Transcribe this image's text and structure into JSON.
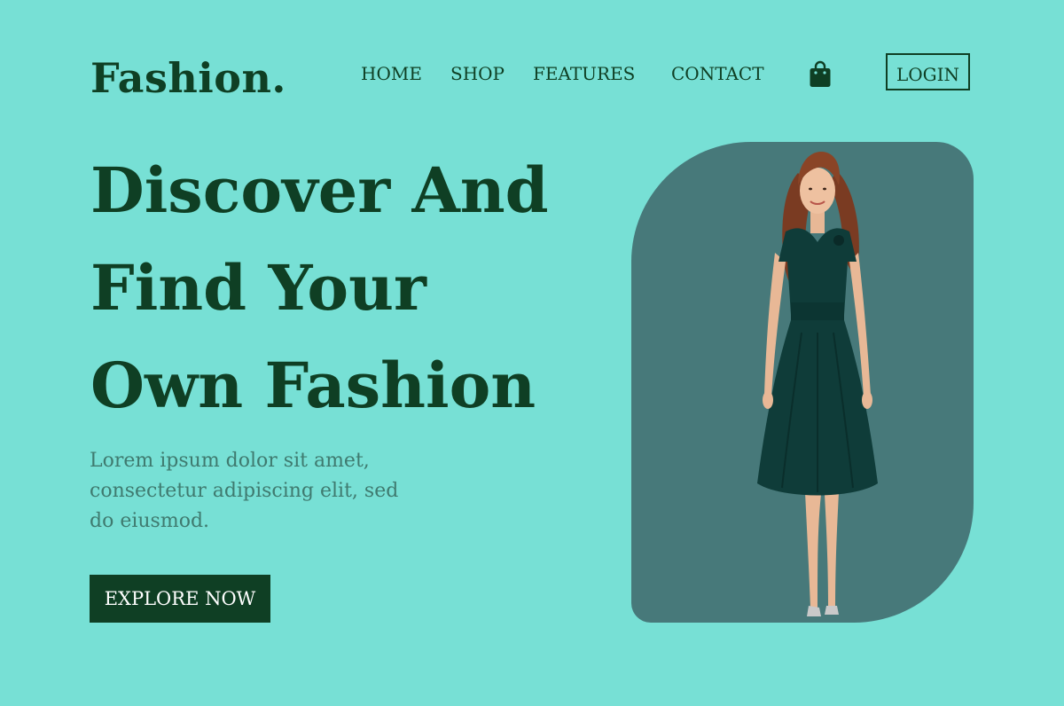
{
  "brand": {
    "logo": "Fashion."
  },
  "nav": {
    "items": [
      {
        "label": "HOME"
      },
      {
        "label": "SHOP"
      },
      {
        "label": "FEATURES"
      },
      {
        "label": "CONTACT"
      }
    ],
    "cart_icon": "shopping-bag-icon",
    "login_label": "LOGIN"
  },
  "hero": {
    "title_lines": [
      "Discover And",
      "Find Your",
      "Own Fashion"
    ],
    "description": "Lorem ipsum dolor sit amet, consectetur adipiscing elit, sed do eiusmod.",
    "cta_label": "EXPLORE NOW",
    "image_subject": "woman-in-green-dress"
  },
  "colors": {
    "background": "#77e0d5",
    "primary_text": "#0f3f24",
    "muted_text": "#3f7a6f",
    "button_bg": "#0f3f24",
    "button_text": "#ffffff",
    "card_bg": "#47797a"
  }
}
